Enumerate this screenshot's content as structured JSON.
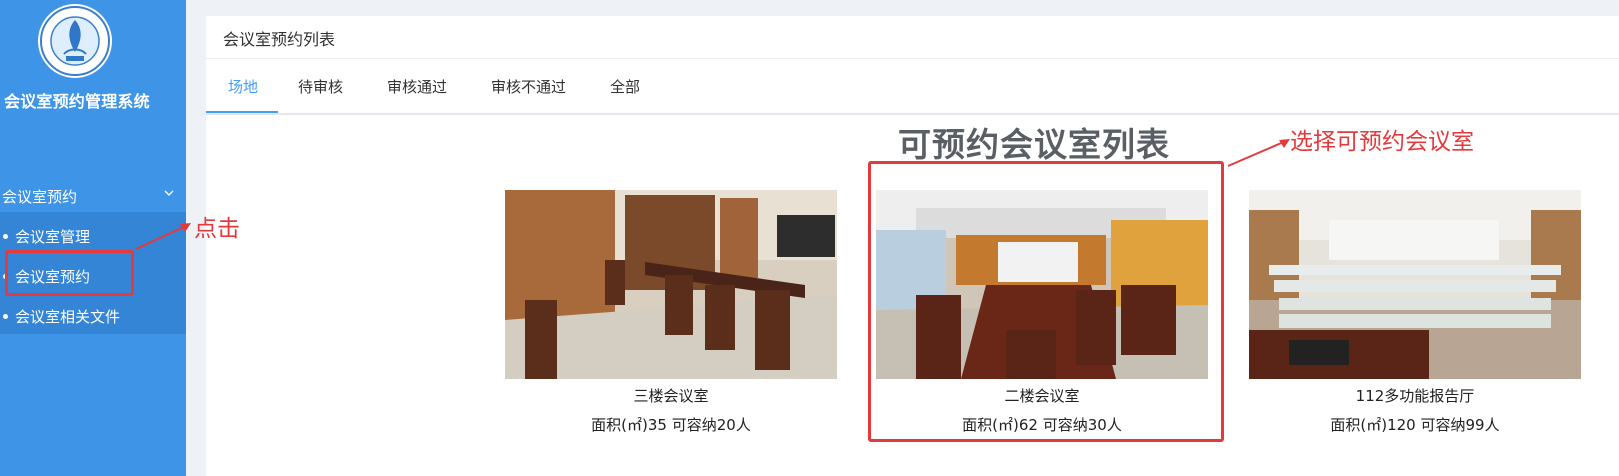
{
  "sidebar": {
    "system_title": "会议室预约管理系统",
    "logo_icon": "university-seal-logo",
    "menu_group": {
      "label": "会议室预约",
      "icon": "chevron-down-icon",
      "expanded": true
    },
    "items": [
      {
        "label": "会议室管理"
      },
      {
        "label": "会议室预约",
        "selected": true
      },
      {
        "label": "会议室相关文件"
      }
    ]
  },
  "main": {
    "panel_title": "会议室预约列表",
    "tabs": [
      {
        "label": "场地",
        "active": true
      },
      {
        "label": "待审核"
      },
      {
        "label": "审核通过"
      },
      {
        "label": "审核不通过"
      },
      {
        "label": "全部"
      }
    ],
    "list_heading": "可预约会议室列表",
    "rooms": [
      {
        "name": "三楼会议室",
        "meta": "面积(㎡)35 可容纳20人"
      },
      {
        "name": "二楼会议室",
        "meta": "面积(㎡)62 可容纳30人"
      },
      {
        "name": "112多功能报告厅",
        "meta": "面积(㎡)120 可容纳99人"
      }
    ]
  },
  "annotations": {
    "click_note": "点击",
    "select_note": "选择可预约会议室",
    "color": "#e5393b"
  },
  "colors": {
    "sidebar": "#3e95e8",
    "accent": "#409eff"
  }
}
